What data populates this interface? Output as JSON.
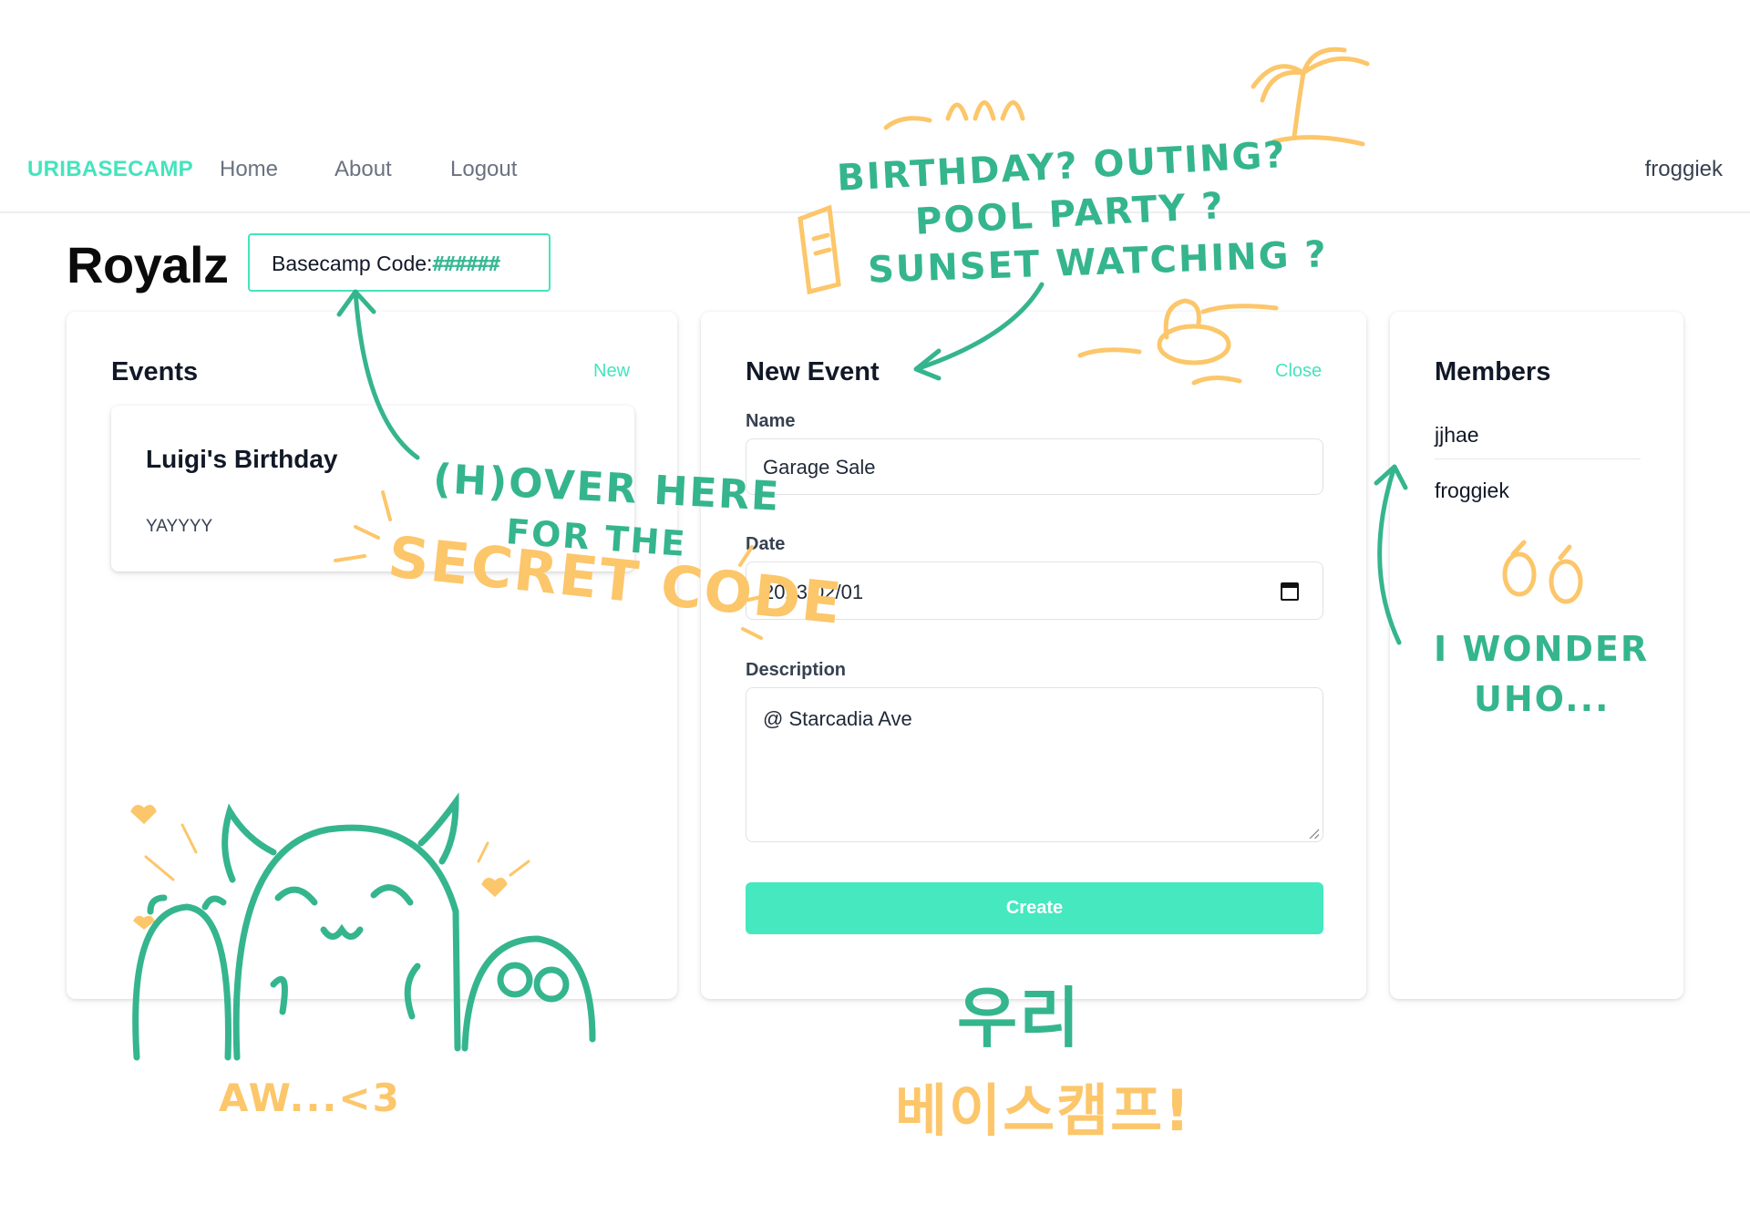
{
  "nav": {
    "brand": "URIBASECAMP",
    "links": [
      "Home",
      "About",
      "Logout"
    ],
    "user": "froggiek"
  },
  "basecamp": {
    "name": "Royalz",
    "code_label": "Basecamp Code:",
    "code_value": "######"
  },
  "events_panel": {
    "title": "Events",
    "new_label": "New",
    "events": [
      {
        "name": "Luigi's Birthday",
        "description": "YAYYYY"
      }
    ]
  },
  "new_event_panel": {
    "title": "New Event",
    "close_label": "Close",
    "name_label": "Name",
    "name_value": "Garage Sale",
    "date_label": "Date",
    "date_value": "2023/02/01",
    "description_label": "Description",
    "description_value": "@ Starcadia Ave",
    "create_label": "Create"
  },
  "members_panel": {
    "title": "Members",
    "members": [
      "jjhae",
      "froggiek"
    ]
  },
  "annotations": {
    "top_line1": "BIRTHDAY? OUTING?",
    "top_line2": "POOL PARTY ?",
    "top_line3": "SUNSET WATCHING ?",
    "hover_line1": "(H)OVER HERE",
    "hover_line2": "FOR THE",
    "secret": "SECRET CODE",
    "wonder_line1": "I WONDER",
    "wonder_line2": "UHO...",
    "aw": "AW...<3",
    "korean_line1": "우리",
    "korean_line2": "베이스캠프!"
  },
  "colors": {
    "accent": "#45e4bd",
    "doodle_teal": "#35b58d",
    "doodle_yellow": "#fcc66a"
  }
}
